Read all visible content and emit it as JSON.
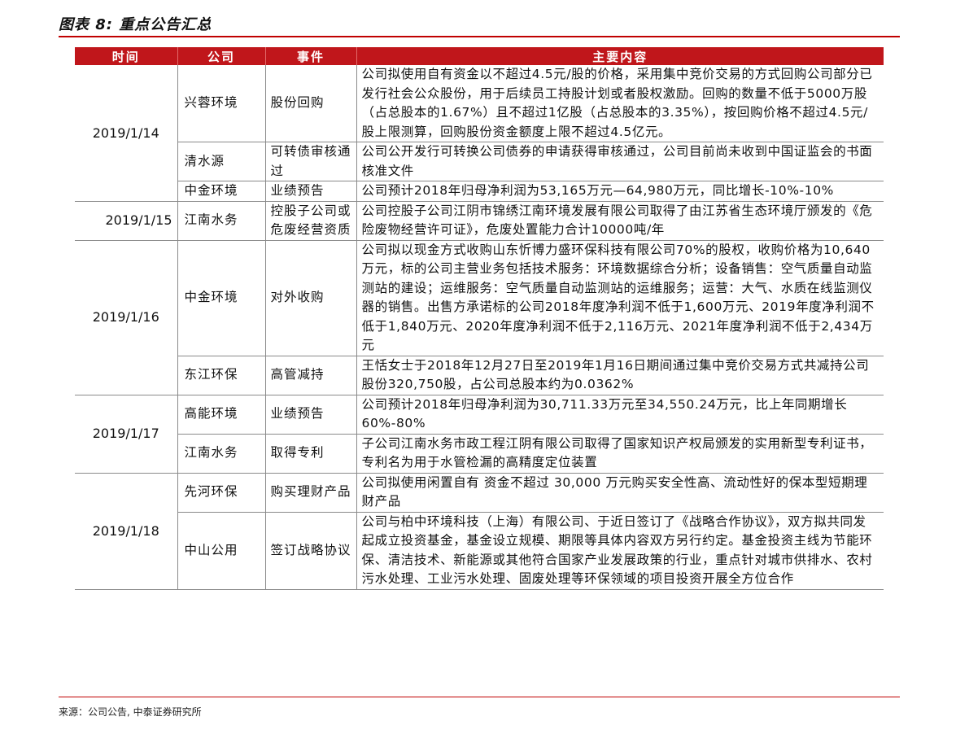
{
  "caption": "图表 8:  重点公告汇总",
  "headers": {
    "time": "时间",
    "company": "公司",
    "event": "事件",
    "content": "主要内容"
  },
  "rows": [
    {
      "date": "2019/1/14",
      "company": "兴蓉环境",
      "event": "股份回购",
      "content": "公司拟使用自有资金以不超过4.5元/股的价格，采用集中竞价交易的方式回购公司部分已发行社会公众股份，用于后续员工持股计划或者股权激励。回购的数量不低于5000万股（占总股本的1.67%）且不超过1亿股（占总股本的3.35%），按回购价格不超过4.5元/股上限测算，回购股份资金额度上限不超过4.5亿元。"
    },
    {
      "date": "",
      "company": "清水源",
      "event": "可转债审核通过",
      "content": "公司公开发行可转换公司债券的申请获得审核通过，公司目前尚未收到中国证监会的书面核准文件"
    },
    {
      "date": "",
      "company": "中金环境",
      "event": "业绩预告",
      "content": "公司预计2018年归母净利润为53,165万元—64,980万元，同比增长-10%-10%"
    },
    {
      "date": "2019/1/15",
      "company": "江南水务",
      "event": "控股子公司或危废经营资质",
      "content": "公司控股子公司江阴市锦绣江南环境发展有限公司取得了由江苏省生态环境厅颁发的《危险废物经营许可证》，危废处置能力合计10000吨/年"
    },
    {
      "date": "2019/1/16",
      "company": "中金环境",
      "event": "对外收购",
      "content": "公司拟以现金方式收购山东忻博力盛环保科技有限公司70%的股权，收购价格为10,640万元，标的公司主营业务包括技术服务：环境数据综合分析；设备销售：空气质量自动监测站的建设；运维服务：空气质量自动监测站的运维服务；运营：大气、水质在线监测仪器的销售。出售方承诺标的公司2018年度净利润不低于1,600万元、2019年度净利润不低于1,840万元、2020年度净利润不低于2,116万元、2021年度净利润不低于2,434万元"
    },
    {
      "date": "",
      "company": "东江环保",
      "event": "高管减持",
      "content": "王恬女士于2018年12月27日至2019年1月16日期间通过集中竞价交易方式共减持公司股份320,750股，占公司总股本约为0.0362%"
    },
    {
      "date": "2019/1/17",
      "company": "高能环境",
      "event": "业绩预告",
      "content": "公司预计2018年归母净利润为30,711.33万元至34,550.24万元，比上年同期增长60%-80%"
    },
    {
      "date": "",
      "company": "江南水务",
      "event": "取得专利",
      "content": "子公司江南水务市政工程江阴有限公司取得了国家知识产权局颁发的实用新型专利证书，专利名为用于水管检漏的高精度定位装置"
    },
    {
      "date": "2019/1/18",
      "company": "先河环保",
      "event": "购买理财产品",
      "content": "公司拟使用闲置自有 资金不超过 30,000 万元购买安全性高、流动性好的保本型短期理财产品"
    },
    {
      "date": "",
      "company": "中山公用",
      "event": "签订战略协议",
      "content": "公司与柏中环境科技（上海）有限公司、于近日签订了《战略合作协议》，双方拟共同发起成立投资基金，基金设立规模、期限等具体内容双方另行约定。基金投资主线为节能环保、清洁技术、新能源或其他符合国家产业发展政策的行业，重点针对城市供排水、农村污水处理、工业污水处理、固废处理等环保领域的项目投资开展全方位合作"
    }
  ],
  "source": "来源：公司公告, 中泰证券研究所"
}
